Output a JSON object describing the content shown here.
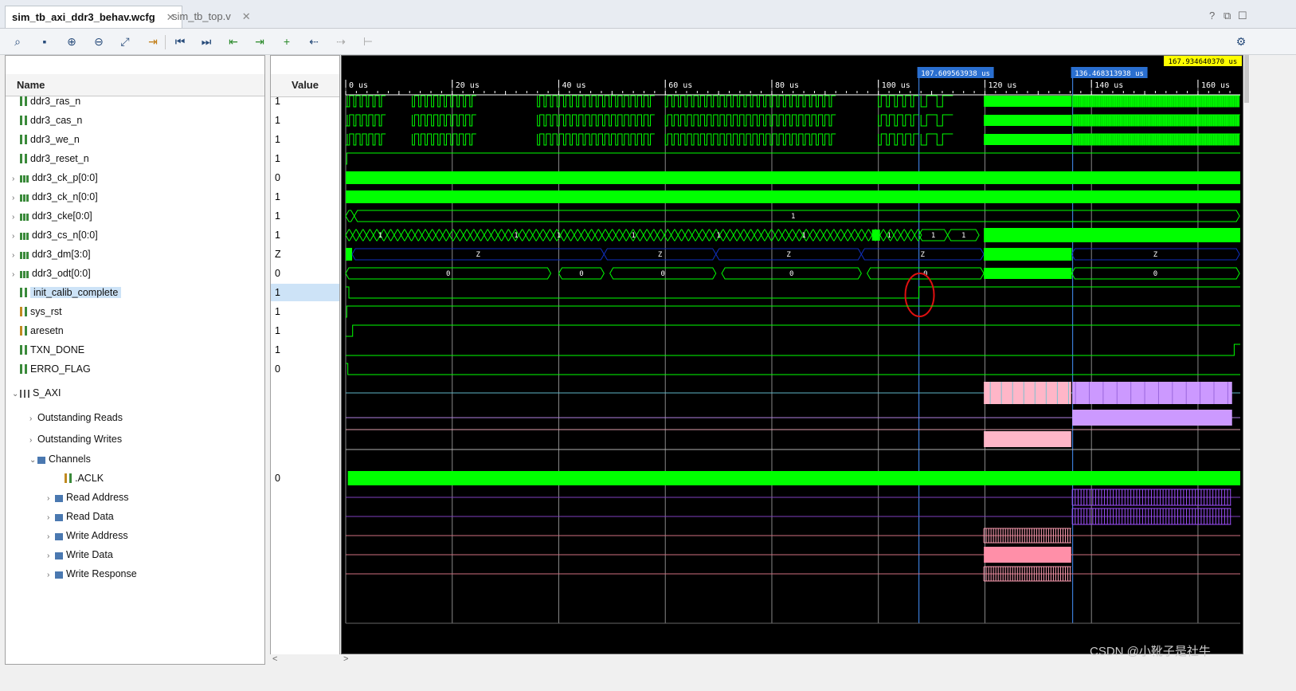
{
  "tabs": [
    {
      "label": "sim_tb_axi_ddr3_behav.wcfg",
      "active": true
    },
    {
      "label": "sim_tb_top.v",
      "active": false
    }
  ],
  "window_controls": [
    "?",
    "⧉",
    "☐"
  ],
  "toolbar_icons": [
    "search-icon",
    "save-icon",
    "zoom-in-icon",
    "zoom-out-icon",
    "zoom-fit-icon",
    "goto-cursor-icon",
    "goto-start-icon",
    "goto-end-icon",
    "prev-transition-icon",
    "next-transition-icon",
    "add-marker-icon",
    "prev-marker-icon",
    "next-marker-icon",
    "swap-cursor-icon",
    "settings-icon"
  ],
  "columns": {
    "name": "Name",
    "value": "Value"
  },
  "signals": [
    {
      "name": "ddr3_ras_n",
      "value": "1",
      "kind": "wire",
      "indent": 0,
      "expand": ""
    },
    {
      "name": "ddr3_cas_n",
      "value": "1",
      "kind": "wire",
      "indent": 0,
      "expand": ""
    },
    {
      "name": "ddr3_we_n",
      "value": "1",
      "kind": "wire",
      "indent": 0,
      "expand": ""
    },
    {
      "name": "ddr3_reset_n",
      "value": "1",
      "kind": "wire",
      "indent": 0,
      "expand": ""
    },
    {
      "name": "ddr3_ck_p[0:0]",
      "value": "0",
      "kind": "bus",
      "indent": 0,
      "expand": ">"
    },
    {
      "name": "ddr3_ck_n[0:0]",
      "value": "1",
      "kind": "bus",
      "indent": 0,
      "expand": ">"
    },
    {
      "name": "ddr3_cke[0:0]",
      "value": "1",
      "kind": "bus",
      "indent": 0,
      "expand": ">"
    },
    {
      "name": "ddr3_cs_n[0:0]",
      "value": "1",
      "kind": "bus",
      "indent": 0,
      "expand": ">"
    },
    {
      "name": "ddr3_dm[3:0]",
      "value": "Z",
      "kind": "bus",
      "indent": 0,
      "expand": ">"
    },
    {
      "name": "ddr3_odt[0:0]",
      "value": "0",
      "kind": "bus",
      "indent": 0,
      "expand": ">"
    },
    {
      "name": "init_calib_complete",
      "value": "1",
      "kind": "wire",
      "indent": 0,
      "expand": "",
      "selected": true
    },
    {
      "name": "sys_rst",
      "value": "1",
      "kind": "wireo",
      "indent": 0,
      "expand": ""
    },
    {
      "name": "aresetn",
      "value": "1",
      "kind": "wireo",
      "indent": 0,
      "expand": ""
    },
    {
      "name": "TXN_DONE",
      "value": "1",
      "kind": "wire",
      "indent": 0,
      "expand": ""
    },
    {
      "name": "ERRO_FLAG",
      "value": "0",
      "kind": "wire",
      "indent": 0,
      "expand": ""
    },
    {
      "name": "S_AXI",
      "value": "",
      "kind": "ifc",
      "indent": 0,
      "expand": "v"
    },
    {
      "name": "Outstanding Reads",
      "value": "",
      "kind": "none",
      "indent": 1,
      "expand": ">"
    },
    {
      "name": "Outstanding Writes",
      "value": "",
      "kind": "none",
      "indent": 1,
      "expand": ">"
    },
    {
      "name": "Channels",
      "value": "",
      "kind": "grp",
      "indent": 1,
      "expand": "v"
    },
    {
      "name": ".ACLK",
      "value": "0",
      "kind": "wireo",
      "indent": 3,
      "expand": ""
    },
    {
      "name": "Read Address",
      "value": "",
      "kind": "grp",
      "indent": 2,
      "expand": ">"
    },
    {
      "name": "Read Data",
      "value": "",
      "kind": "grp",
      "indent": 2,
      "expand": ">"
    },
    {
      "name": "Write Address",
      "value": "",
      "kind": "grp",
      "indent": 2,
      "expand": ">"
    },
    {
      "name": "Write Data",
      "value": "",
      "kind": "grp",
      "indent": 2,
      "expand": ">"
    },
    {
      "name": "Write Response",
      "value": "",
      "kind": "grp",
      "indent": 2,
      "expand": ">"
    }
  ],
  "timeline": {
    "ticks": [
      "0 us",
      "20 us",
      "40 us",
      "60 us",
      "80 us",
      "100 us",
      "120 us",
      "140 us",
      "160 us"
    ],
    "tick_values": [
      0,
      20,
      40,
      60,
      80,
      100,
      120,
      140,
      160
    ],
    "range_us": [
      0,
      167.93464037
    ],
    "cursor_label": "167.934640370 us",
    "markers": [
      {
        "label": "107.609563938 us",
        "time": 107.609563938
      },
      {
        "label": "136.468313938 us",
        "time": 136.468313938
      }
    ]
  },
  "bus_labels": {
    "cke": "1",
    "cs_n": [
      "1",
      "1",
      "1",
      "1",
      "1",
      "1",
      "1",
      "1",
      "1"
    ],
    "cs_n_late": [
      "1",
      "1"
    ],
    "dm": [
      "Z",
      "Z",
      "Z",
      "Z",
      "Z",
      "Z"
    ],
    "odt": [
      "0",
      "0",
      "0",
      "0",
      "0",
      "0"
    ]
  },
  "scroll": {
    "left": "<",
    "right": ">"
  },
  "watermark": "CSDN @小靴子是社牛"
}
